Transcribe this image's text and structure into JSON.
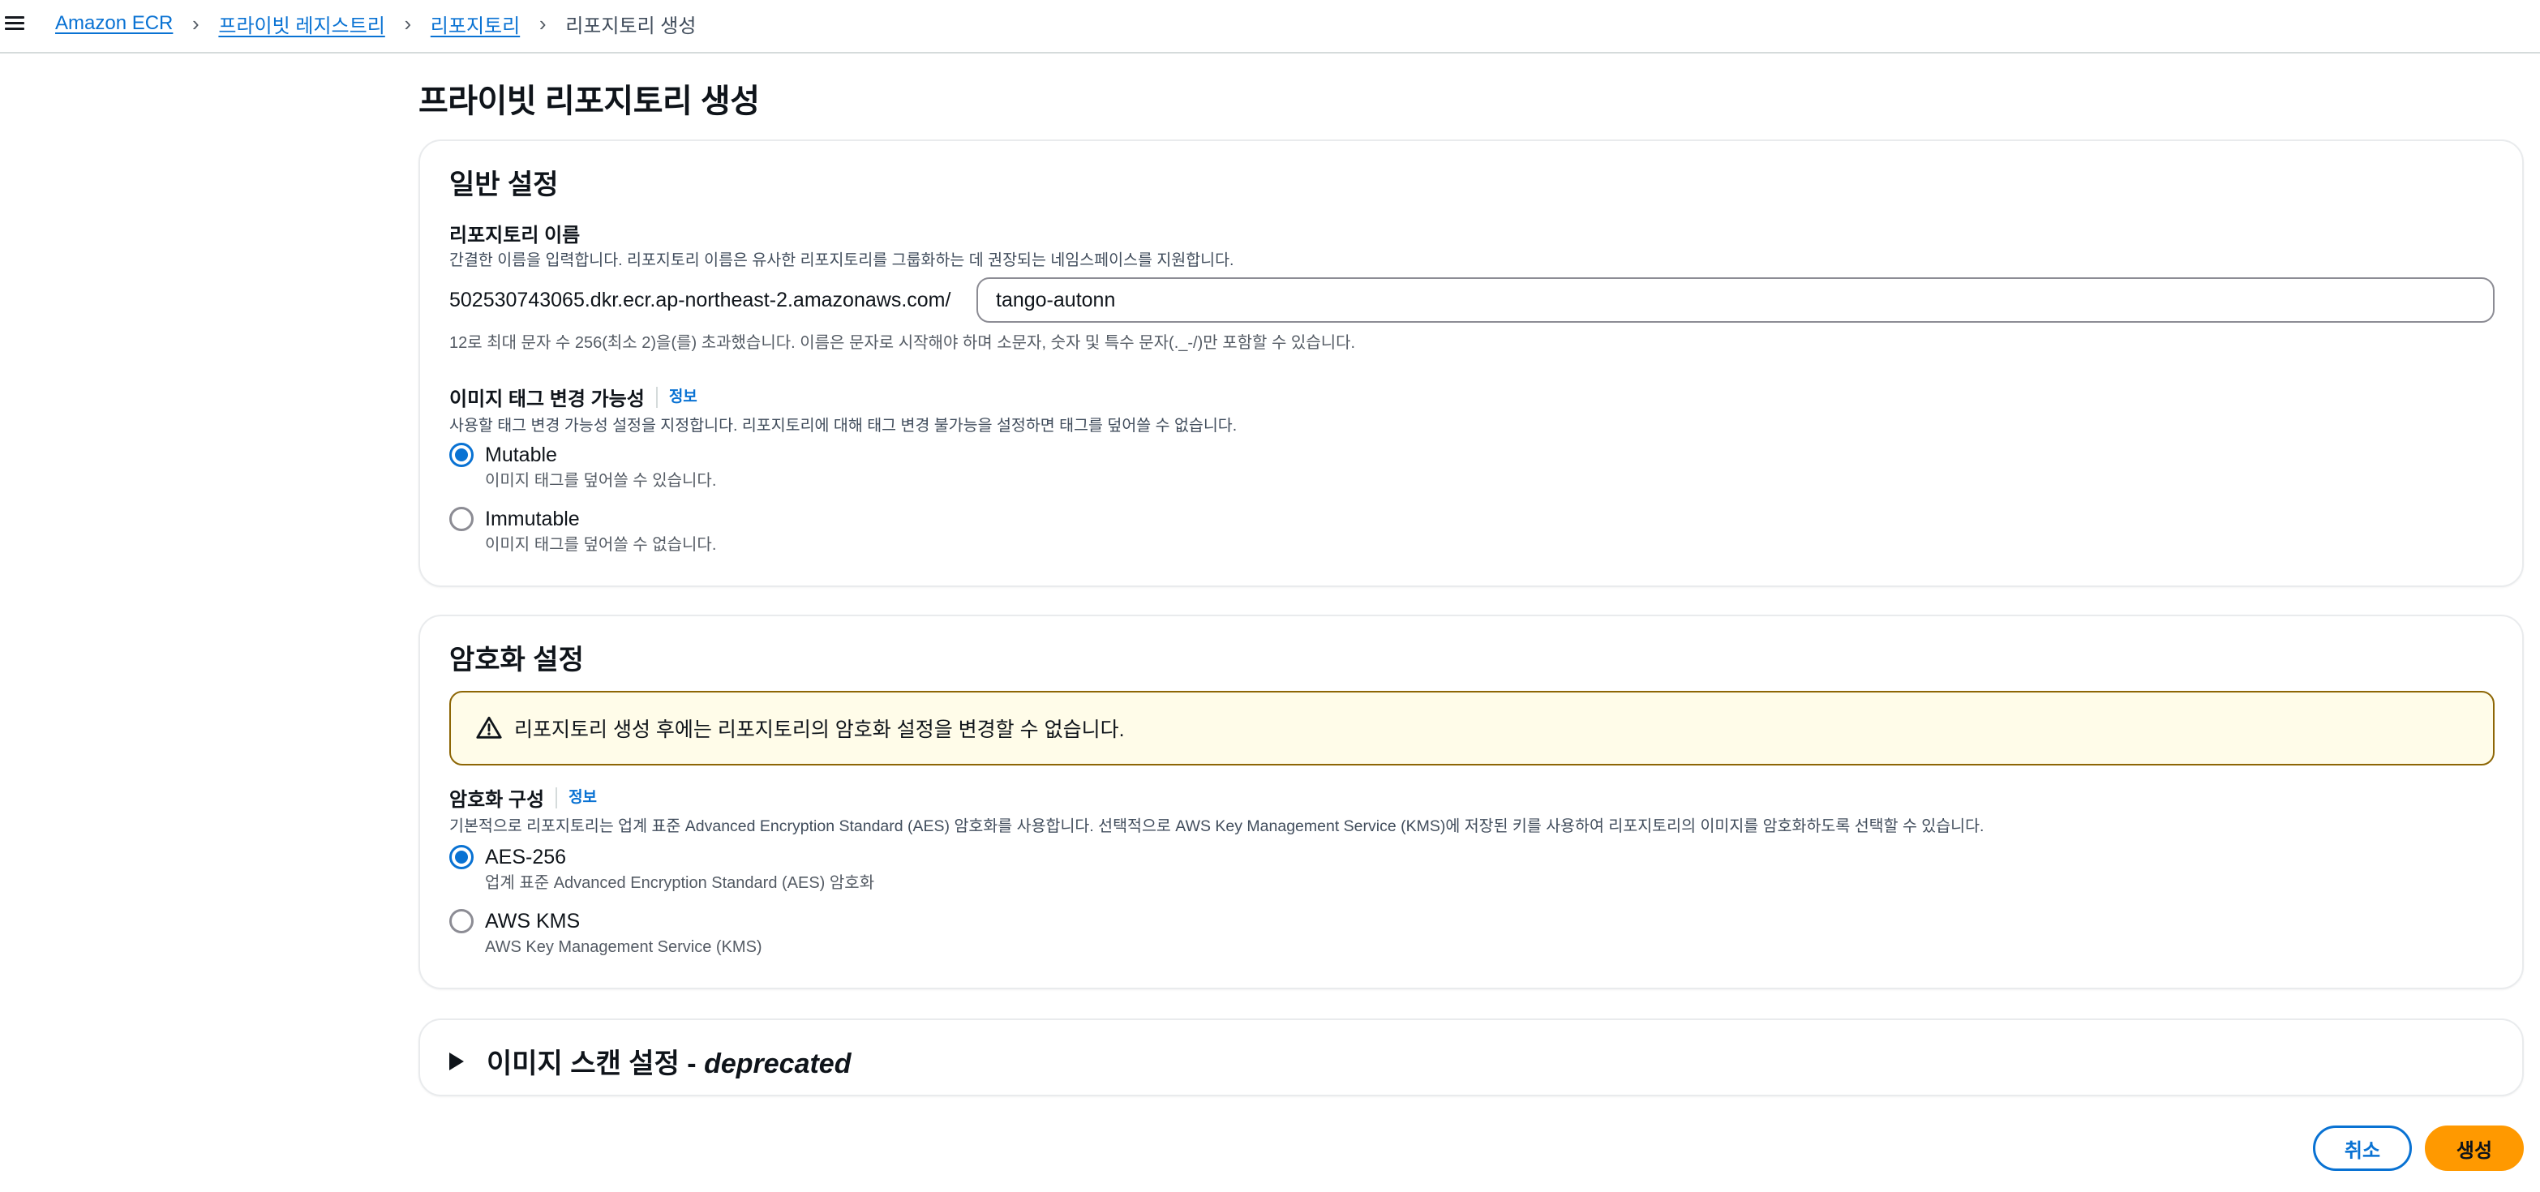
{
  "breadcrumbs": [
    {
      "label": "Amazon ECR"
    },
    {
      "label": "프라이빗 레지스트리"
    },
    {
      "label": "리포지토리"
    },
    {
      "label": "리포지토리 생성"
    }
  ],
  "page_title": "프라이빗 리포지토리 생성",
  "general": {
    "title": "일반 설정",
    "repo_name_label": "리포지토리 이름",
    "repo_name_desc": "간결한 이름을 입력합니다. 리포지토리 이름은 유사한 리포지토리를 그룹화하는 데 권장되는 네임스페이스를 지원합니다.",
    "uri_prefix": "502530743065.dkr.ecr.ap-northeast-2.amazonaws.com/",
    "repo_name_value": "tango-autonn",
    "repo_name_constraint": "12로 최대 문자 수 256(최소 2)을(를) 초과했습니다. 이름은 문자로 시작해야 하며 소문자, 숫자 및 특수 문자(._-/)만 포함할 수 있습니다.",
    "mutability_label": "이미지 태그 변경 가능성",
    "info": "정보",
    "mutability_desc": "사용할 태그 변경 가능성 설정을 지정합니다. 리포지토리에 대해 태그 변경 불가능을 설정하면 태그를 덮어쓸 수 없습니다.",
    "options": [
      {
        "label": "Mutable",
        "desc": "이미지 태그를 덮어쓸 수 있습니다.",
        "checked": true
      },
      {
        "label": "Immutable",
        "desc": "이미지 태그를 덮어쓸 수 없습니다.",
        "checked": false
      }
    ]
  },
  "encryption": {
    "title": "암호화 설정",
    "alert": "리포지토리 생성 후에는 리포지토리의 암호화 설정을 변경할 수 없습니다.",
    "config_label": "암호화 구성",
    "info": "정보",
    "config_desc": "기본적으로 리포지토리는 업계 표준 Advanced Encryption Standard (AES) 암호화를 사용합니다. 선택적으로 AWS Key Management Service (KMS)에 저장된 키를 사용하여 리포지토리의 이미지를 암호화하도록 선택할 수 있습니다.",
    "options": [
      {
        "label": "AES-256",
        "desc": "업계 표준 Advanced Encryption Standard (AES) 암호화",
        "checked": true
      },
      {
        "label": "AWS KMS",
        "desc": "AWS Key Management Service (KMS)",
        "checked": false
      }
    ]
  },
  "scan": {
    "title": "이미지 스캔 설정 - ",
    "deprecated": "deprecated"
  },
  "actions": {
    "cancel": "취소",
    "create": "생성"
  },
  "colors": {
    "link": "#0972d3",
    "primary_button": "#ff9900",
    "warning_border": "#8d6605",
    "warning_bg": "#fffce9"
  }
}
